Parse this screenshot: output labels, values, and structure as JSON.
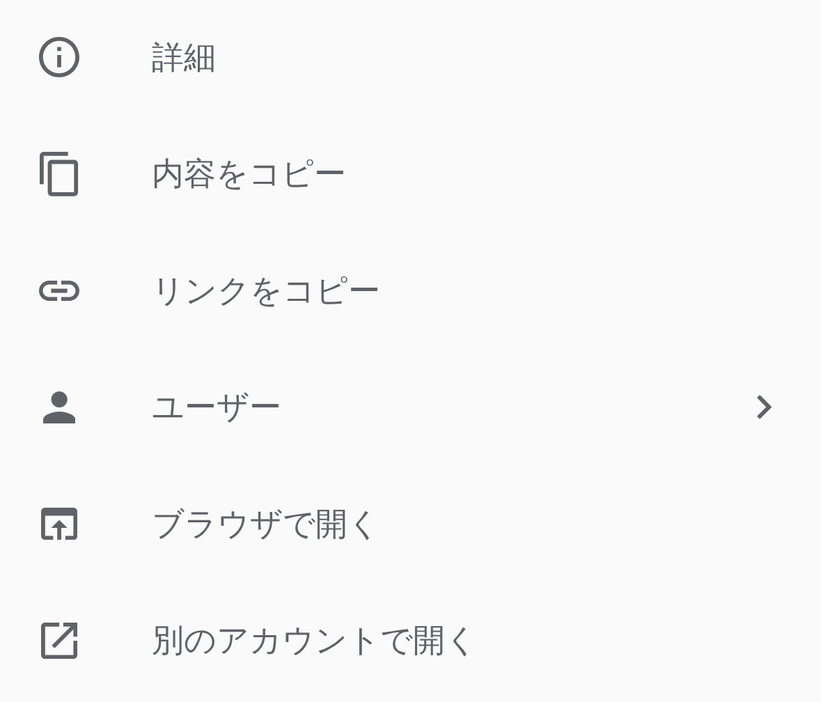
{
  "menu": {
    "items": [
      {
        "label": "詳細",
        "has_submenu": false
      },
      {
        "label": "内容をコピー",
        "has_submenu": false
      },
      {
        "label": "リンクをコピー",
        "has_submenu": false
      },
      {
        "label": "ユーザー",
        "has_submenu": true
      },
      {
        "label": "ブラウザで開く",
        "has_submenu": false
      },
      {
        "label": "別のアカウントで開く",
        "has_submenu": false
      }
    ]
  }
}
